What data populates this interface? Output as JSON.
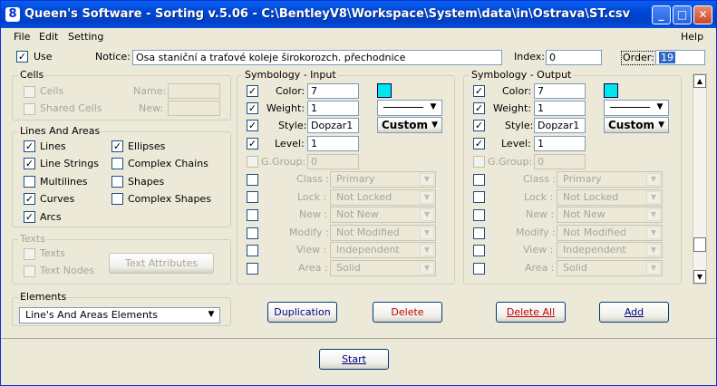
{
  "window": {
    "title": "Queen's Software - Sorting v.5.06 - C:\\BentleyV8\\Workspace\\System\\data\\in\\Ostrava\\ST.csv",
    "icon_letter": "8",
    "minimize": "_",
    "maximize": "□",
    "close": "✕"
  },
  "menu": {
    "file": "File",
    "edit": "Edit",
    "setting": "Setting",
    "help": "Help"
  },
  "top": {
    "use_label": "Use",
    "notice_label": "Notice:",
    "notice_value": "Osa staniční a traťové koleje širokorozch. přechodnice",
    "index_label": "Index:",
    "index_value": "0",
    "order_label": "Order:",
    "order_value": "19"
  },
  "cells": {
    "title": "Cells",
    "cells_label": "Cells",
    "shared_label": "Shared Cells",
    "name_label": "Name:",
    "new_label": "New:"
  },
  "lines": {
    "title": "Lines And Areas",
    "lines": "Lines",
    "line_strings": "Line Strings",
    "multilines": "Multilines",
    "curves": "Curves",
    "arcs": "Arcs",
    "ellipses": "Ellipses",
    "complex_chains": "Complex Chains",
    "shapes": "Shapes",
    "complex_shapes": "Complex Shapes"
  },
  "texts": {
    "title": "Texts",
    "texts": "Texts",
    "text_nodes": "Text Nodes",
    "attr_button": "Text Attributes"
  },
  "elements": {
    "title": "Elements",
    "selected": "Line's And Areas Elements"
  },
  "sym_in": {
    "title": "Symbology - Input",
    "color_label": "Color:",
    "color_value": "7",
    "weight_label": "Weight:",
    "weight_value": "1",
    "style_label": "Style:",
    "style_value": "Dopzar1",
    "level_label": "Level:",
    "level_value": "1",
    "ggroup_label": "G.Group:",
    "ggroup_value": "0",
    "custom": "Custom",
    "class_label": "Class :",
    "class_value": "Primary",
    "lock_label": "Lock :",
    "lock_value": "Not Locked",
    "new_label": "New :",
    "new_value": "Not New",
    "modify_label": "Modify :",
    "modify_value": "Not Modified",
    "view_label": "View :",
    "view_value": "Independent",
    "area_label": "Area :",
    "area_value": "Solid",
    "swatch_color": "#00E5EE"
  },
  "sym_out": {
    "title": "Symbology - Output",
    "color_label": "Color:",
    "color_value": "7",
    "weight_label": "Weight:",
    "weight_value": "1",
    "style_label": "Style:",
    "style_value": "Dopzar1",
    "level_label": "Level:",
    "level_value": "1",
    "ggroup_label": "G.Group:",
    "ggroup_value": "0",
    "custom": "Custom",
    "class_label": "Class :",
    "class_value": "Primary",
    "lock_label": "Lock :",
    "lock_value": "Not Locked",
    "new_label": "New :",
    "new_value": "Not New",
    "modify_label": "Modify :",
    "modify_value": "Not Modified",
    "view_label": "View :",
    "view_value": "Independent",
    "area_label": "Area :",
    "area_value": "Solid",
    "swatch_color": "#00E5EE"
  },
  "actions": {
    "duplication": "Duplication",
    "delete": "Delete",
    "delete_all": "Delete All",
    "add": "Add",
    "start": "Start"
  },
  "scroll": {
    "up": "▲",
    "down": "▼"
  },
  "glyphs": {
    "check": "✓",
    "arrow": "▼"
  }
}
